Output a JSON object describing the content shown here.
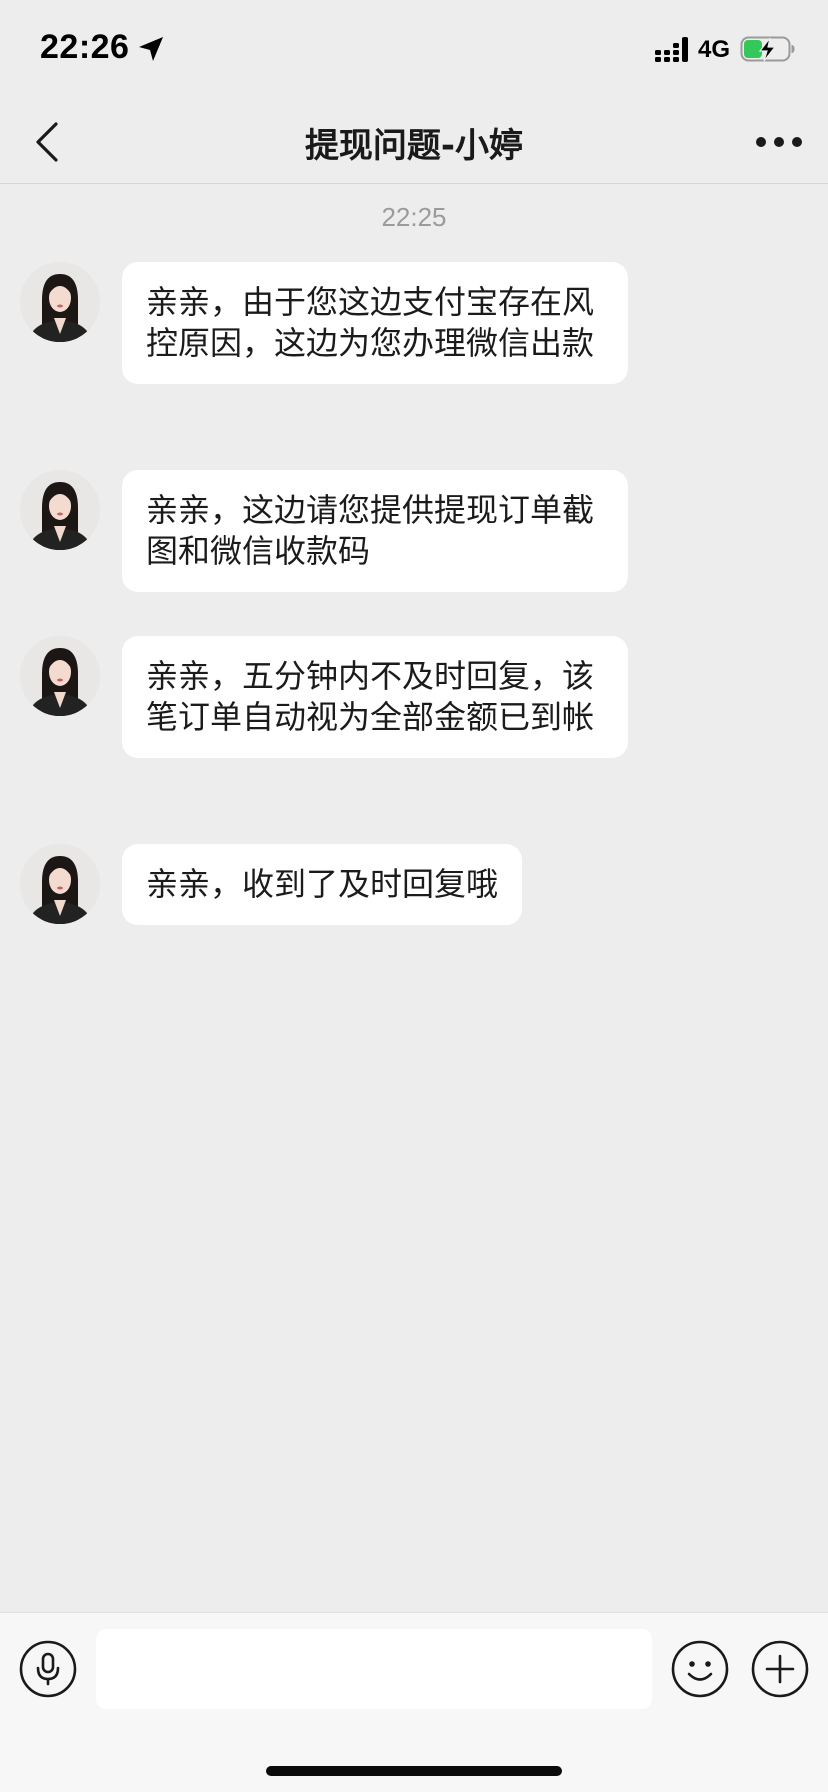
{
  "status_bar": {
    "time": "22:26",
    "network": "4G",
    "icons": [
      "location-arrow-icon",
      "signal-icon",
      "battery-charging-icon"
    ],
    "battery_color": "#34c759"
  },
  "nav": {
    "title": "提现问题-小婷",
    "back_icon": "chevron-left-icon",
    "more_icon": "more-dots-icon"
  },
  "chat": {
    "timestamp": "22:25",
    "messages": [
      {
        "sender": "incoming",
        "text": "亲亲，由于您这边支付宝存在风控原因，这边为您办理微信出款"
      },
      {
        "sender": "incoming",
        "text": "亲亲，这边请您提供提现订单截图和微信收款码"
      },
      {
        "sender": "incoming",
        "text": "亲亲，五分钟内不及时回复，该笔订单自动视为全部金额已到帐"
      },
      {
        "sender": "incoming",
        "text": "亲亲，收到了及时回复哦"
      }
    ]
  },
  "input_bar": {
    "value": "",
    "placeholder": "",
    "icons": [
      "microphone-icon",
      "emoji-icon",
      "plus-icon"
    ]
  },
  "colors": {
    "background": "#ededed",
    "bubble": "#ffffff",
    "input_bar": "#f7f7f7"
  }
}
